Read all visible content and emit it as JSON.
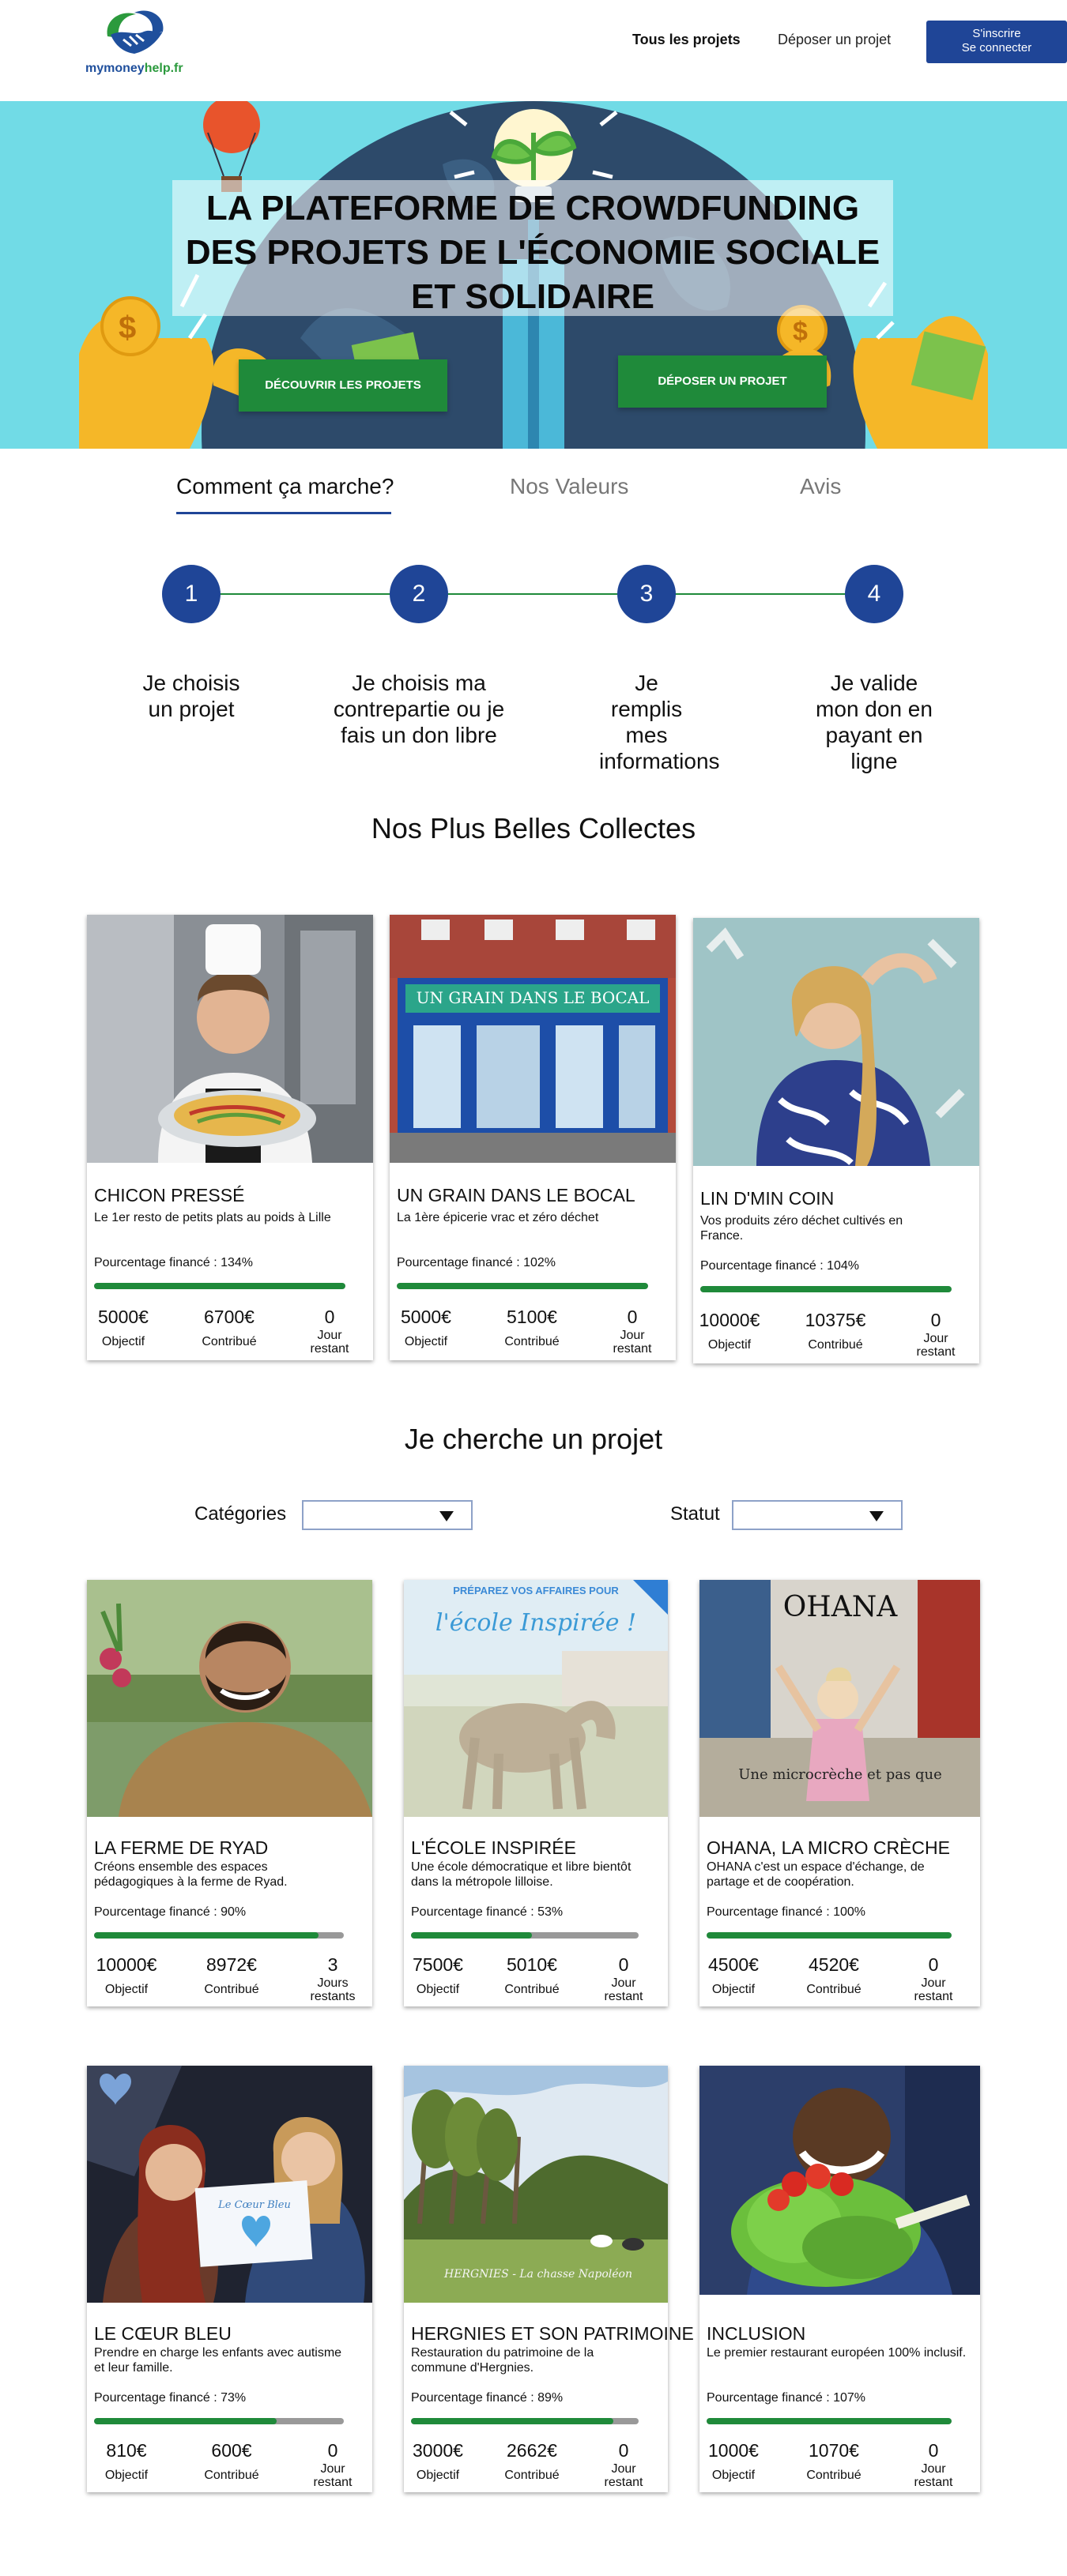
{
  "header": {
    "logo_text_a": "mymoney",
    "logo_text_b": "help.fr",
    "nav_all": "Tous les projets",
    "nav_deposit": "Déposer un projet",
    "signup": "S'inscrire",
    "login": "Se connecter"
  },
  "hero": {
    "title": "LA PLATEFORME DE CROWDFUNDING DES PROJETS DE L'ÉCONOMIE SOCIALE ET SOLIDAIRE",
    "btn_discover": "DÉCOUVRIR LES PROJETS",
    "btn_deposit": "DÉPOSER UN PROJET"
  },
  "tabs": [
    "Comment ça marche?",
    "Nos Valeurs",
    "Avis"
  ],
  "steps": [
    {
      "num": "1",
      "text": "Je choisis un projet"
    },
    {
      "num": "2",
      "text": "Je choisis ma contrepartie ou je fais un don libre"
    },
    {
      "num": "3",
      "text": "Je remplis mes informations"
    },
    {
      "num": "4",
      "text": "Je valide mon don en payant en ligne"
    }
  ],
  "best_title": "Nos Plus Belles Collectes",
  "search_title": "Je cherche un projet",
  "filters": {
    "categories": "Catégories",
    "status": "Statut"
  },
  "labels": {
    "objective": "Objectif",
    "contributed": "Contribué"
  },
  "best": [
    {
      "title": "CHICON PRESSÉ",
      "desc": "Le 1er resto de petits plats au poids à Lille",
      "pct_label": "Pourcentage financé : 134%",
      "pct": 1.0,
      "goal": "5000€",
      "contrib": "6700€",
      "days": "0",
      "days_label": "Jour restant"
    },
    {
      "title": "UN GRAIN DANS LE BOCAL",
      "desc": "La 1ère épicerie vrac et zéro déchet",
      "pct_label": "Pourcentage financé : 102%",
      "pct": 1.0,
      "goal": "5000€",
      "contrib": "5100€",
      "days": "0",
      "days_label": "Jour restant"
    },
    {
      "title": "LIN D'MIN COIN",
      "desc": "Vos produits zéro déchet cultivés en France.",
      "pct_label": "Pourcentage financé : 104%",
      "pct": 1.0,
      "goal": "10000€",
      "contrib": "10375€",
      "days": "0",
      "days_label": "Jour restant"
    }
  ],
  "projects": [
    {
      "title": "LA FERME DE RYAD",
      "desc": "Créons ensemble des espaces pédagogiques à la ferme de Ryad.",
      "pct_label": "Pourcentage financé : 90%",
      "pct": 0.9,
      "goal": "10000€",
      "contrib": "8972€",
      "days": "3",
      "days_label": "Jours restants"
    },
    {
      "title": "L'ÉCOLE INSPIRÉE",
      "desc": "Une école démocratique et libre bientôt dans la métropole lilloise.",
      "pct_label": "Pourcentage financé : 53%",
      "pct": 0.53,
      "goal": "7500€",
      "contrib": "5010€",
      "days": "0",
      "days_label": "Jour restant",
      "img_caption_a": "PRÉPAREZ VOS AFFAIRES POUR",
      "img_caption_b": "l'école Inspirée !"
    },
    {
      "title": "OHANA, LA MICRO CRÈCHE",
      "desc": "OHANA c'est un espace d'échange, de partage et de coopération.",
      "pct_label": "Pourcentage financé : 100%",
      "pct": 1.0,
      "goal": "4500€",
      "contrib": "4520€",
      "days": "0",
      "days_label": "Jour restant",
      "img_caption_a": "OHANA",
      "img_caption_b": "Une microcrèche et pas que"
    },
    {
      "title": "LE CŒUR BLEU",
      "desc": "Prendre en charge les enfants avec autisme et leur famille.",
      "pct_label": "Pourcentage financé : 73%",
      "pct": 0.73,
      "goal": "810€",
      "contrib": "600€",
      "days": "0",
      "days_label": "Jour restant",
      "img_caption_a": "Le Cœur Bleu"
    },
    {
      "title": "HERGNIES ET SON PATRIMOINE",
      "desc": "Restauration du patrimoine de la commune d'Hergnies.",
      "pct_label": "Pourcentage financé : 89%",
      "pct": 0.89,
      "goal": "3000€",
      "contrib": "2662€",
      "days": "0",
      "days_label": "Jour restant",
      "img_caption_a": "HERGNIES - La chasse Napoléon"
    },
    {
      "title": "INCLUSION",
      "desc": "Le premier restaurant européen 100% inclusif.",
      "pct_label": "Pourcentage financé : 107%",
      "pct": 1.0,
      "goal": "1000€",
      "contrib": "1070€",
      "days": "0",
      "days_label": "Jour restant"
    }
  ],
  "colors": {
    "navy": "#1f4597",
    "green": "#1f8a3a",
    "hero_bg": "#71dbe6"
  }
}
